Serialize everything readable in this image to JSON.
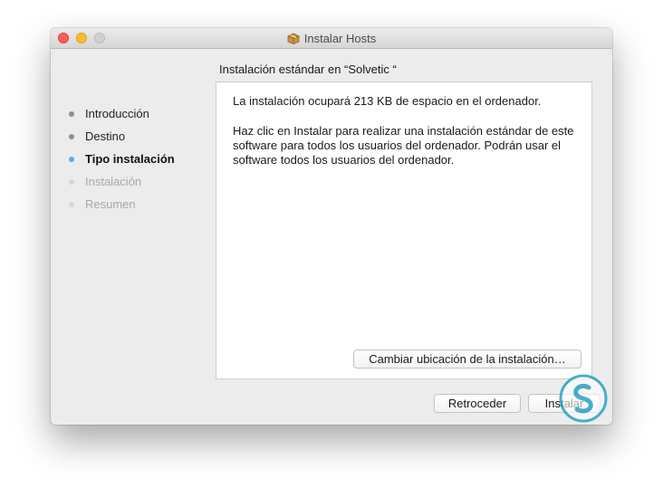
{
  "window": {
    "title": "Instalar Hosts",
    "title_icon": "package-icon"
  },
  "heading": "Instalación estándar en “Solvetic “",
  "steps": [
    {
      "label": "Introducción",
      "state": "done"
    },
    {
      "label": "Destino",
      "state": "done"
    },
    {
      "label": "Tipo instalación",
      "state": "current"
    },
    {
      "label": "Instalación",
      "state": "pending"
    },
    {
      "label": "Resumen",
      "state": "pending"
    }
  ],
  "content": {
    "space_text": "La instalación ocupará 213 KB de espacio en el ordenador.",
    "description": "Haz clic en Instalar para realizar una instalación estándar de este software para todos los usuarios del ordenador. Podrán usar el software todos los usuarios del ordenador.",
    "change_location_button": "Cambiar ubicación de la instalación…"
  },
  "buttons": {
    "back": "Retroceder",
    "install": "Instalar"
  },
  "colors": {
    "close": "#fc5f57",
    "minimize": "#fdbc2e",
    "current_step_bullet": "#5ea8e8",
    "watermark": "#2aa1c8"
  }
}
